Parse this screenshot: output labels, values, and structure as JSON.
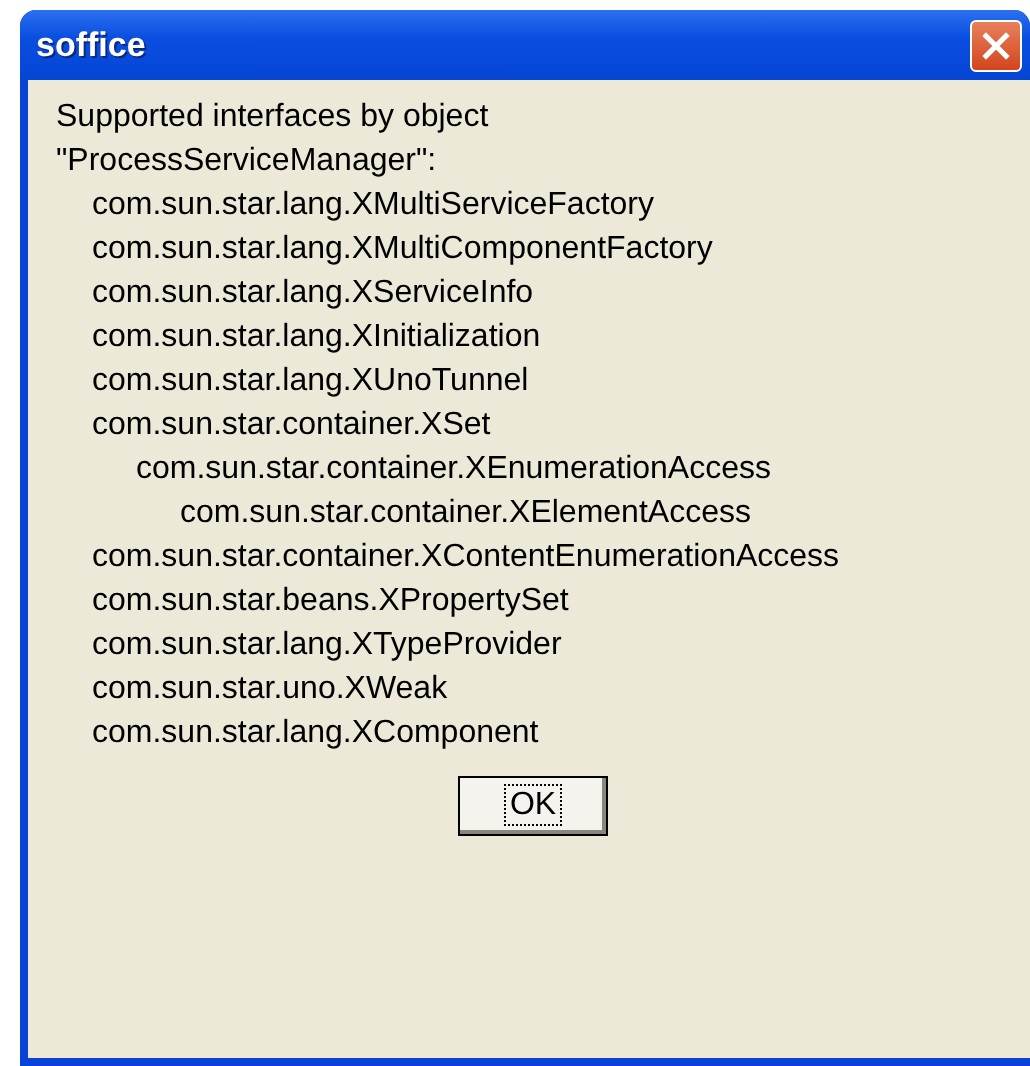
{
  "window": {
    "title": "soffice"
  },
  "message": [
    "Supported interfaces by object",
    "\"ProcessServiceManager\":"
  ],
  "interfaces": [
    {
      "name": "com.sun.star.lang.XMultiServiceFactory"
    },
    {
      "name": "com.sun.star.lang.XMultiComponentFactory"
    },
    {
      "name": "com.sun.star.lang.XServiceInfo"
    },
    {
      "name": "com.sun.star.lang.XInitialization"
    },
    {
      "name": "com.sun.star.lang.XUnoTunnel"
    },
    {
      "name": "com.sun.star.container.XSet",
      "children": [
        {
          "name": "com.sun.star.container.XEnumerationAccess",
          "children": [
            {
              "name": "com.sun.star.container.XElementAccess"
            }
          ]
        }
      ]
    },
    {
      "name": "com.sun.star.container.XContentEnumerationAccess"
    },
    {
      "name": "com.sun.star.beans.XPropertySet"
    },
    {
      "name": "com.sun.star.lang.XTypeProvider"
    },
    {
      "name": "com.sun.star.uno.XWeak"
    },
    {
      "name": "com.sun.star.lang.XComponent"
    }
  ],
  "buttons": [
    "OK"
  ]
}
